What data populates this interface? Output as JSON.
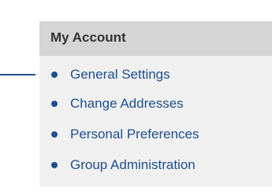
{
  "account_menu": {
    "title": "My Account",
    "items": [
      {
        "label": "General Settings"
      },
      {
        "label": "Change Addresses"
      },
      {
        "label": "Personal Preferences"
      },
      {
        "label": "Group Administration"
      }
    ],
    "link_color": "#1f4f8f",
    "header_color": "#d5d5d5",
    "panel_color": "#f0f0f0"
  },
  "icons": {
    "bullet": "bullet-icon"
  }
}
